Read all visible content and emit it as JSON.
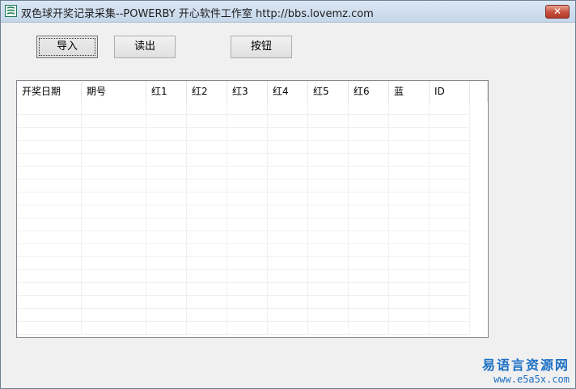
{
  "window": {
    "title": "双色球开奖记录采集--POWERBY 开心软件工作室 http://bbs.lovemz.com",
    "close_label": "✕"
  },
  "buttons": {
    "import_label": "导入",
    "read_label": "读出",
    "generic_label": "按钮"
  },
  "table": {
    "columns": [
      "开奖日期",
      "期号",
      "红1",
      "红2",
      "红3",
      "红4",
      "红5",
      "红6",
      "蓝",
      "ID"
    ],
    "rows": []
  },
  "watermark": {
    "line1": "易语言资源网",
    "line2": "www.e5a5x.com"
  }
}
